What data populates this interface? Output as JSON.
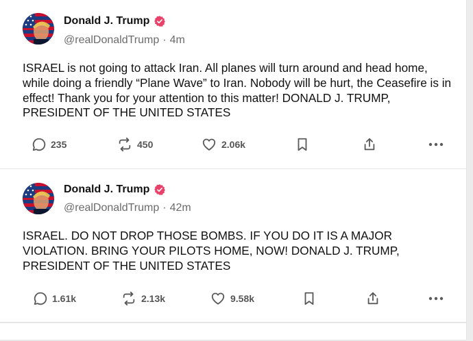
{
  "posts": [
    {
      "author": "Donald J. Trump",
      "handle": "@realDonaldTrump",
      "time": "4m",
      "text": "ISRAEL is not going to attack Iran. All planes will turn around and head home, while doing a friendly “Plane Wave” to Iran. Nobody will be hurt, the Ceasefire is in effect! Thank you for your attention to this matter! DONALD J. TRUMP, PRESIDENT OF THE UNITED STATES",
      "replies": "235",
      "retruths": "450",
      "likes": "2.06k"
    },
    {
      "author": "Donald J. Trump",
      "handle": "@realDonaldTrump",
      "time": "42m",
      "text": "ISRAEL. DO NOT DROP THOSE BOMBS. IF YOU DO IT IS A MAJOR VIOLATION. BRING YOUR PILOTS HOME, NOW!  DONALD J. TRUMP, PRESIDENT OF THE UNITED STATES",
      "replies": "1.61k",
      "retruths": "2.13k",
      "likes": "9.58k"
    }
  ],
  "icons": {
    "reply": "reply-icon",
    "retruth": "retruth-icon",
    "like": "heart-icon",
    "bookmark": "bookmark-icon",
    "share": "share-icon",
    "more": "more-icon",
    "verified": "verified-badge-icon"
  },
  "colors": {
    "verified": "#e8426a",
    "icon": "#5a5a5a",
    "muted_text": "#6b6b6b"
  }
}
